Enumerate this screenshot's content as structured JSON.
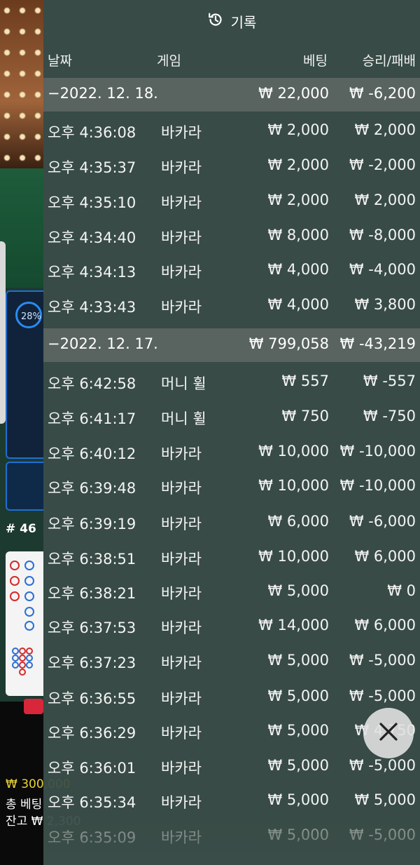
{
  "background": {
    "progress_percent_label": "28%",
    "round_label": "# 46",
    "balance_lines": [
      "₩ 300,000",
      "총 베팅",
      "잔고 ₩ 2,300"
    ]
  },
  "header": {
    "icon": "history-icon",
    "title": "기록"
  },
  "columns": {
    "date": "날짜",
    "game": "게임",
    "bet": "베팅",
    "win_loss": "승리/패배"
  },
  "groups": [
    {
      "date": "−2022. 12. 18.",
      "bet": "₩ 22,000",
      "win_loss": "₩ -6,200",
      "rows": [
        {
          "time": "오후 4:36:08",
          "game": "바카라",
          "bet": "₩ 2,000",
          "win_loss": "₩ 2,000"
        },
        {
          "time": "오후 4:35:37",
          "game": "바카라",
          "bet": "₩ 2,000",
          "win_loss": "₩ -2,000"
        },
        {
          "time": "오후 4:35:10",
          "game": "바카라",
          "bet": "₩ 2,000",
          "win_loss": "₩ 2,000"
        },
        {
          "time": "오후 4:34:40",
          "game": "바카라",
          "bet": "₩ 8,000",
          "win_loss": "₩ -8,000"
        },
        {
          "time": "오후 4:34:13",
          "game": "바카라",
          "bet": "₩ 4,000",
          "win_loss": "₩ -4,000"
        },
        {
          "time": "오후 4:33:43",
          "game": "바카라",
          "bet": "₩ 4,000",
          "win_loss": "₩ 3,800"
        }
      ]
    },
    {
      "date": "−2022. 12. 17.",
      "bet": "₩ 799,058",
      "win_loss": "₩ -43,219",
      "rows": [
        {
          "time": "오후 6:42:58",
          "game": "머니 휠",
          "bet": "₩ 557",
          "win_loss": "₩ -557"
        },
        {
          "time": "오후 6:41:17",
          "game": "머니 휠",
          "bet": "₩ 750",
          "win_loss": "₩ -750"
        },
        {
          "time": "오후 6:40:12",
          "game": "바카라",
          "bet": "₩ 10,000",
          "win_loss": "₩ -10,000"
        },
        {
          "time": "오후 6:39:48",
          "game": "바카라",
          "bet": "₩ 10,000",
          "win_loss": "₩ -10,000"
        },
        {
          "time": "오후 6:39:19",
          "game": "바카라",
          "bet": "₩ 6,000",
          "win_loss": "₩ -6,000"
        },
        {
          "time": "오후 6:38:51",
          "game": "바카라",
          "bet": "₩ 10,000",
          "win_loss": "₩ 6,000"
        },
        {
          "time": "오후 6:38:21",
          "game": "바카라",
          "bet": "₩ 5,000",
          "win_loss": "₩ 0"
        },
        {
          "time": "오후 6:37:53",
          "game": "바카라",
          "bet": "₩ 14,000",
          "win_loss": "₩ 6,000"
        },
        {
          "time": "오후 6:37:23",
          "game": "바카라",
          "bet": "₩ 5,000",
          "win_loss": "₩ -5,000"
        },
        {
          "time": "오후 6:36:55",
          "game": "바카라",
          "bet": "₩ 5,000",
          "win_loss": "₩ -5,000"
        },
        {
          "time": "오후 6:36:29",
          "game": "바카라",
          "bet": "₩ 5,000",
          "win_loss": "₩ 4,750"
        },
        {
          "time": "오후 6:36:01",
          "game": "바카라",
          "bet": "₩ 5,000",
          "win_loss": "₩ -5,000"
        },
        {
          "time": "오후 6:35:34",
          "game": "바카라",
          "bet": "₩ 5,000",
          "win_loss": "₩ 5,000"
        },
        {
          "time": "오후 6:35:09",
          "game": "바카라",
          "bet": "₩ 5,000",
          "win_loss": "₩ -5,000"
        }
      ]
    }
  ],
  "close_button": {
    "icon": "close-icon"
  }
}
